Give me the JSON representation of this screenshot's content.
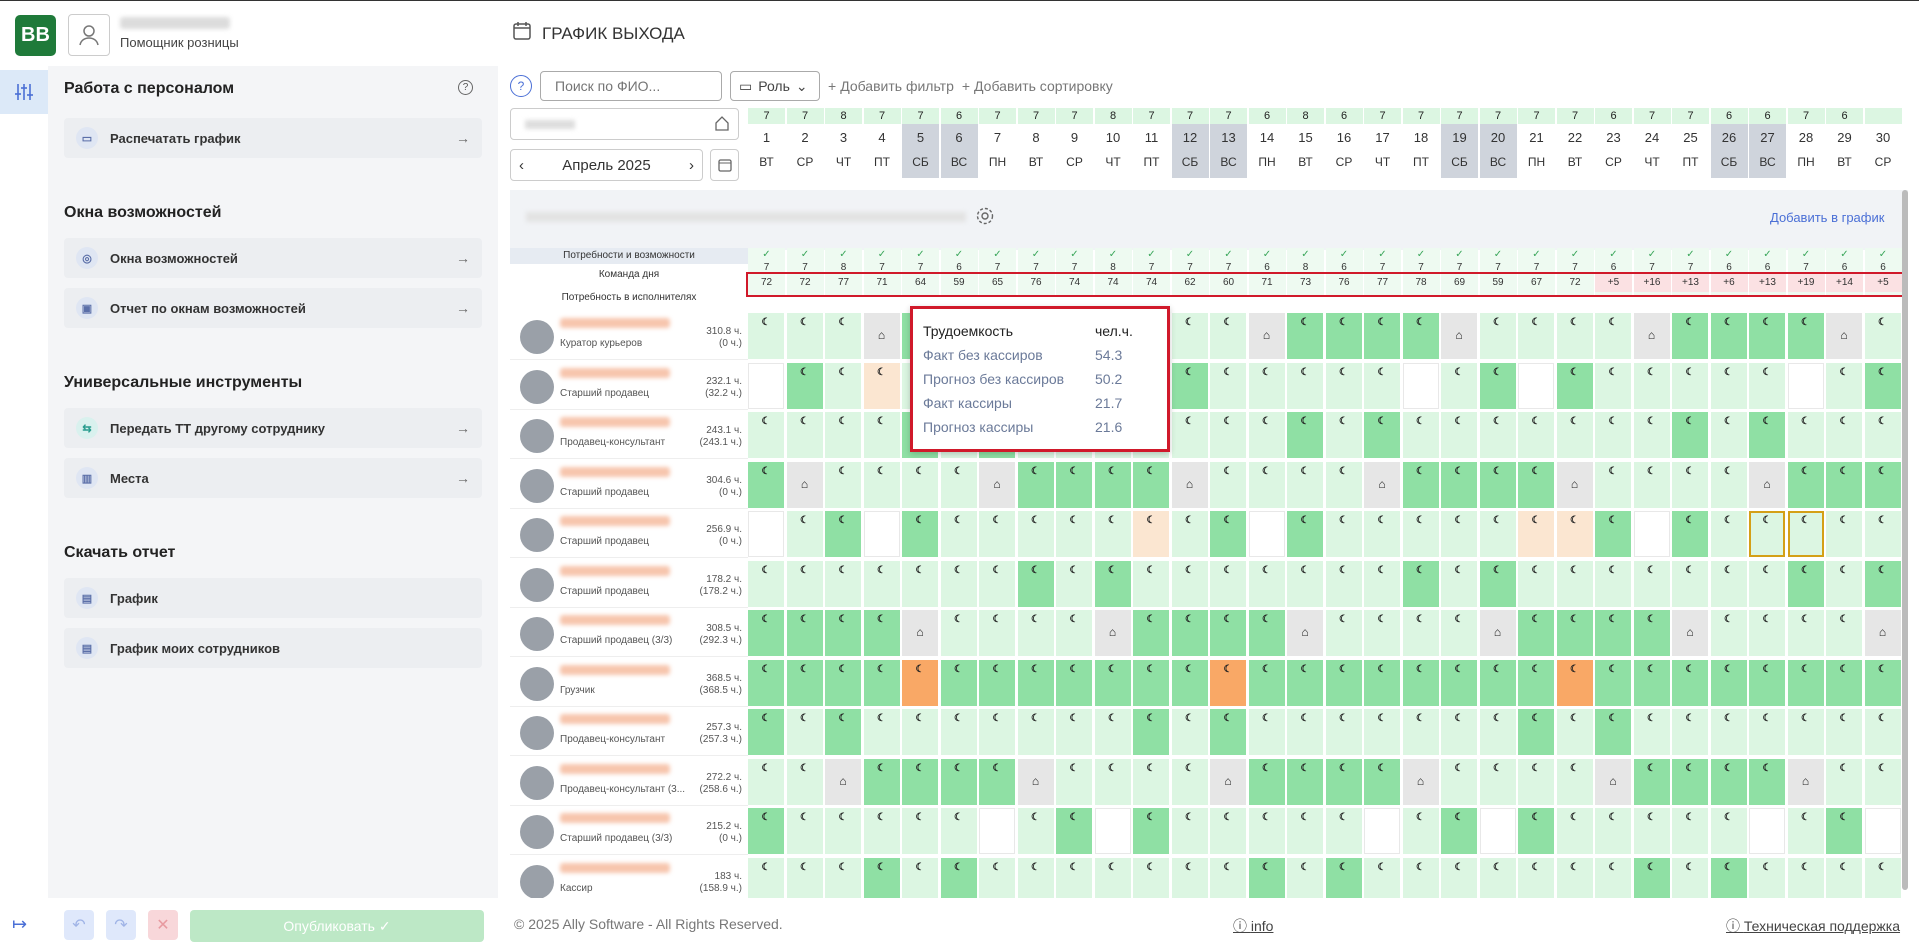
{
  "app": {
    "logo": "BB",
    "user_role": "Помощник розницы",
    "page_title": "ГРАФИК ВЫХОДА"
  },
  "sidebar": {
    "section1": "Работа с персоналом",
    "print": "Распечатать график",
    "section2": "Окна возможностей",
    "windows": "Окна возможностей",
    "report_windows": "Отчет по окнам возможностей",
    "section3": "Универсальные инструменты",
    "transfer": "Передать ТТ другому сотруднику",
    "places": "Места",
    "section4": "Скачать отчет",
    "report_schedule": "График",
    "report_my": "График моих сотрудников"
  },
  "toolbar": {
    "search_placeholder": "Поиск по ФИО...",
    "role": "Роль",
    "add_filter": "Добавить фильтр",
    "add_sort": "Добавить сортировку"
  },
  "calendar": {
    "month": "Апрель 2025",
    "add_to_schedule": "Добавить в график",
    "counts": [
      "7",
      "7",
      "8",
      "7",
      "7",
      "6",
      "7",
      "7",
      "7",
      "8",
      "7",
      "7",
      "7",
      "6",
      "8",
      "6",
      "7",
      "7",
      "7",
      "7",
      "7",
      "7",
      "6",
      "7",
      "7",
      "6",
      "6",
      "7",
      "6"
    ],
    "days": [
      "1",
      "2",
      "3",
      "4",
      "5",
      "6",
      "7",
      "8",
      "9",
      "10",
      "11",
      "12",
      "13",
      "14",
      "15",
      "16",
      "17",
      "18",
      "19",
      "20",
      "21",
      "22",
      "23",
      "24",
      "25",
      "26",
      "27",
      "28",
      "29",
      "30"
    ],
    "weekdays": [
      "ВТ",
      "СР",
      "ЧТ",
      "ПТ",
      "СБ",
      "ВС",
      "ПН",
      "ВТ",
      "СР",
      "ЧТ",
      "ПТ",
      "СБ",
      "ВС",
      "ПН",
      "ВТ",
      "СР",
      "ЧТ",
      "ПТ",
      "СБ",
      "ВС",
      "ПН",
      "ВТ",
      "СР",
      "ЧТ",
      "ПТ",
      "СБ",
      "ВС",
      "ПН",
      "ВТ",
      "СР"
    ],
    "team": [
      "72",
      "72",
      "77",
      "71",
      "64",
      "59",
      "65",
      "76",
      "74",
      "74",
      "74",
      "62",
      "60",
      "71",
      "73",
      "76",
      "77",
      "78",
      "69",
      "59",
      "67",
      "72",
      "+5",
      "+16",
      "+13",
      "+6",
      "+13",
      "+19",
      "+14",
      "+5"
    ]
  },
  "labels": {
    "needs": "Потребности и возможности",
    "team": "Команда дня",
    "demand": "Потребность в исполнителях"
  },
  "employees": [
    {
      "role": "Куратор курьеров",
      "h1": "310.8 ч.",
      "h2": "(0 ч.)"
    },
    {
      "role": "Старший продавец",
      "h1": "232.1 ч.",
      "h2": "(32.2 ч.)"
    },
    {
      "role": "Продавец-консультант",
      "h1": "243.1 ч.",
      "h2": "(243.1 ч.)"
    },
    {
      "role": "Старший продавец",
      "h1": "304.6 ч.",
      "h2": "(0 ч.)"
    },
    {
      "role": "Старший продавец",
      "h1": "256.9 ч.",
      "h2": "(0 ч.)"
    },
    {
      "role": "Старший продавец",
      "h1": "178.2 ч.",
      "h2": "(178.2 ч.)"
    },
    {
      "role": "Старший продавец (3/3)",
      "h1": "308.5 ч.",
      "h2": "(292.3 ч.)"
    },
    {
      "role": "Грузчик",
      "h1": "368.5 ч.",
      "h2": "(368.5 ч.)"
    },
    {
      "role": "Продавец-консультант",
      "h1": "257.3 ч.",
      "h2": "(257.3 ч.)"
    },
    {
      "role": "Продавец-консультант (3...",
      "h1": "272.2 ч.",
      "h2": "(258.6 ч.)"
    },
    {
      "role": "Старший продавец (3/3)",
      "h1": "215.2 ч.",
      "h2": "(0 ч.)"
    },
    {
      "role": "Кассир",
      "h1": "183 ч.",
      "h2": "(158.9 ч.)"
    }
  ],
  "tooltip": {
    "h1": "Трудоемкость",
    "h2": "чел.ч.",
    "rows": [
      {
        "k": "Факт без кассиров",
        "v": "54.3"
      },
      {
        "k": "Прогноз без кассиров",
        "v": "50.2"
      },
      {
        "k": "Факт кассиры",
        "v": "21.7"
      },
      {
        "k": "Прогноз кассиры",
        "v": "21.6"
      }
    ]
  },
  "footer": {
    "publish": "Опубликовать",
    "copyright": "© 2025 Ally Software - All Rights Reserved.",
    "info": "info",
    "support": "Техническая поддержка"
  }
}
